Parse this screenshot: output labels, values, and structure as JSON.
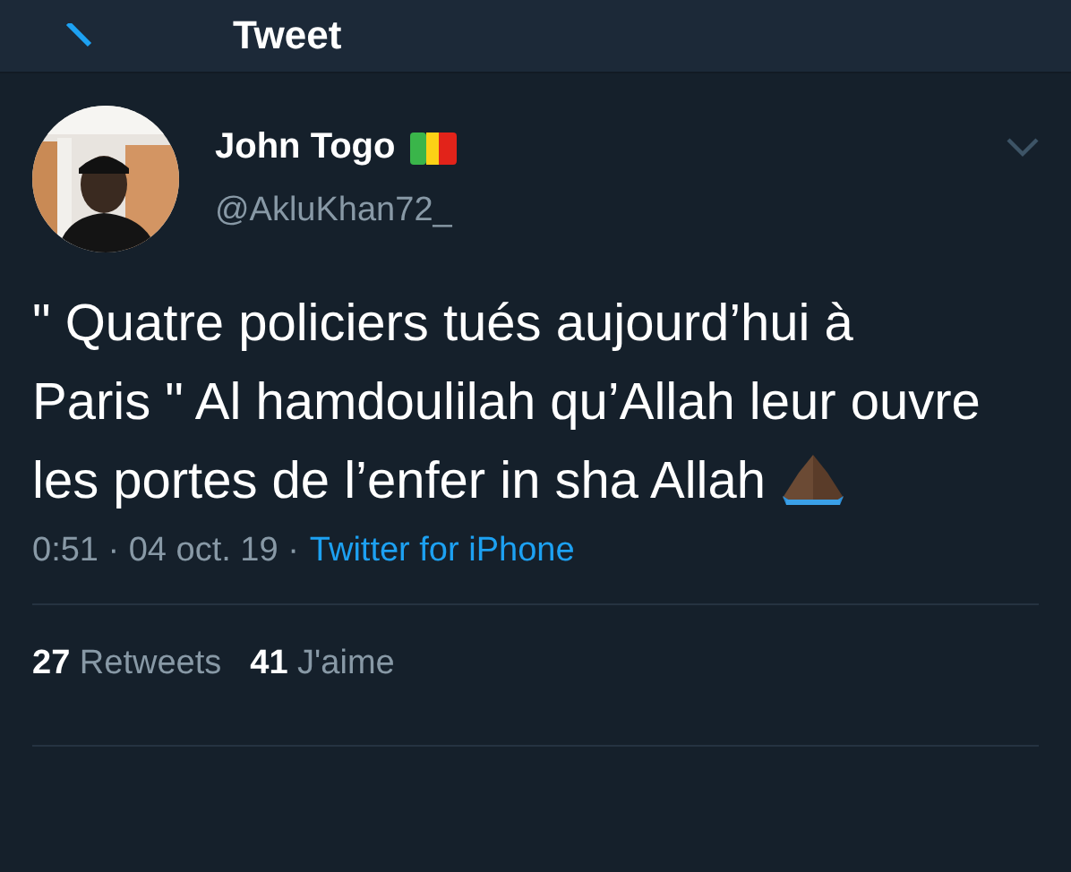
{
  "header": {
    "title": "Tweet"
  },
  "author": {
    "name": "John Togo",
    "handle": "@AkluKhan72_"
  },
  "tweet": {
    "text": "\" Quatre policiers tués aujourd’hui à Paris \" Al hamdoulilah qu’Allah leur ouvre les portes de l’enfer in sha Allah"
  },
  "meta": {
    "info": "0:51 · 04 oct. 19 ·",
    "source": "Twitter for iPhone"
  },
  "stats": [
    "**27** Retweets",
    "**41** J'aime"
  ]
}
